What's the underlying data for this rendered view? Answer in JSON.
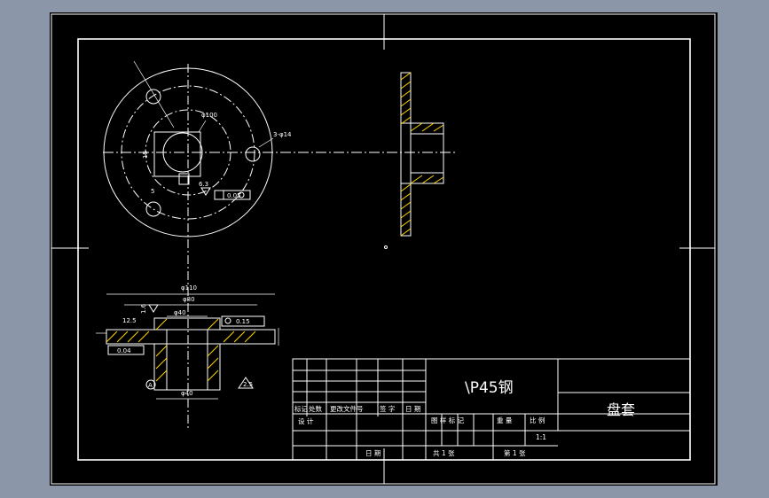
{
  "viewport": {
    "background": "#000000",
    "frame": "#8b96a8"
  },
  "colors": {
    "line": "#ffffff",
    "hatch": "#ffd700",
    "center_line": "#ffffff"
  },
  "title_block": {
    "material": "\\P45钢",
    "part_name": "盘套",
    "rev_labels": [
      "标记",
      "处数",
      "更改文件号",
      "签 字",
      "日 期"
    ],
    "design_label": "设 计",
    "date_label": "日 期",
    "stage_labels": [
      "图 样 标 记",
      "重 量",
      "比 例"
    ],
    "scale_value": "1:1",
    "sheet_total": "共  1  张",
    "sheet_no": "第  1  张"
  },
  "dimensions": {
    "outer_dia": "φ100",
    "pcd": "φ80",
    "bolt_holes": "3-φ14",
    "keyway_width": "5",
    "keyway_depth": "15",
    "flatness": "0.05",
    "roughness_1": "6.3",
    "top_dia_1": "φ110",
    "top_dia_2": "φ80",
    "top_dia_3": "φ40",
    "top_tol": "0.15",
    "flange_thk": "12.5",
    "hub_dia": "φ40",
    "left_tol": "0.04",
    "roughness_2": "1.6",
    "datum": "A",
    "center_mark": "2.5"
  }
}
